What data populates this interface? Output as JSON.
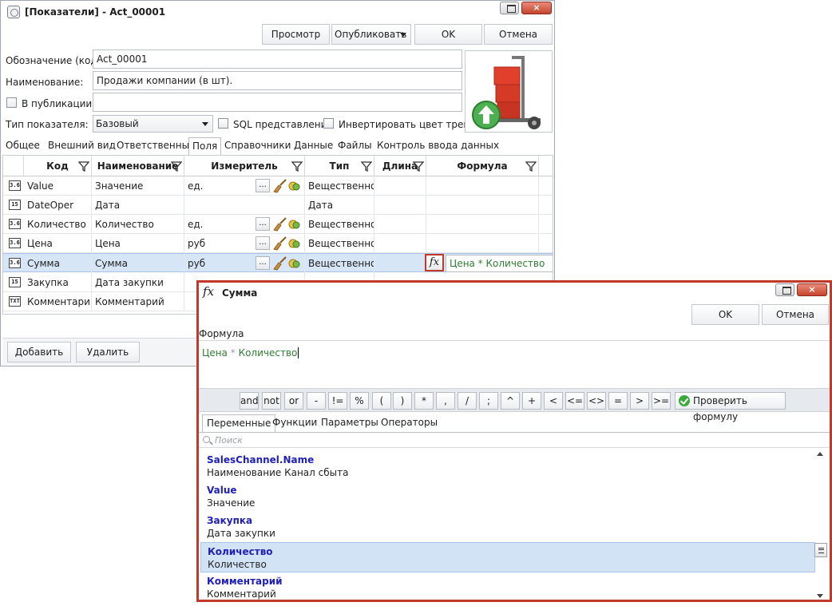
{
  "main": {
    "title": "[Показатели] - Act_00001",
    "toolbar": {
      "preview": "Просмотр",
      "publish": "Опубликовать",
      "ok": "OK",
      "cancel": "Отмена"
    },
    "form": {
      "code_label": "Обозначение (код):",
      "code_value": "Act_00001",
      "name_label": "Наименование:",
      "name_value": "Продажи компании (в шт).",
      "publication_label": "В публикации:",
      "publication_value": "",
      "type_label": "Тип показателя:",
      "type_value": "Базовый",
      "sql_label": "SQL представление",
      "invert_label": "Инвертировать цвет тренда"
    },
    "tabs": [
      "Общее",
      "Внешний вид",
      "Ответственные",
      "Поля",
      "Справочники",
      "Данные",
      "Файлы",
      "Контроль ввода данных"
    ],
    "active_tab": "Поля",
    "grid": {
      "headers": [
        "Код",
        "Наименование",
        "Измеритель",
        "Тип",
        "Длина",
        "Формула"
      ],
      "rows": [
        {
          "icon": "3.6",
          "code": "Value",
          "name": "Значение",
          "unit": "ед.",
          "type": "Вещественное",
          "formula": ""
        },
        {
          "icon": "15",
          "code": "DateOper",
          "name": "Дата",
          "unit": "",
          "type": "Дата",
          "formula": ""
        },
        {
          "icon": "3.6",
          "code": "Количество",
          "name": "Количество",
          "unit": "ед.",
          "type": "Вещественное",
          "formula": ""
        },
        {
          "icon": "3.6",
          "code": "Цена",
          "name": "Цена",
          "unit": "руб",
          "type": "Вещественное",
          "formula": ""
        },
        {
          "icon": "3.6",
          "code": "Сумма",
          "name": "Сумма",
          "unit": "руб",
          "type": "Вещественное",
          "formula": "Цена * Количество"
        },
        {
          "icon": "15",
          "code": "Закупка",
          "name": "Дата закупки",
          "unit": "",
          "type": "",
          "formula": ""
        },
        {
          "icon": "TXT",
          "code": "Комментарий",
          "name": "Комментарий",
          "unit": "",
          "type": "",
          "formula": ""
        }
      ],
      "ellipsis": "..."
    },
    "bottom": {
      "add": "Добавить",
      "delete": "Удалить"
    }
  },
  "dialog": {
    "title": "Сумма",
    "fx_glyph": "fx",
    "ok": "OK",
    "cancel": "Отмена",
    "formula_label": "Формула",
    "formula_name": "Цена",
    "formula_op": "*",
    "formula_qty": "Количество",
    "operators": [
      "and",
      "not",
      "or",
      "-",
      "!=",
      "%",
      "(",
      ")",
      "*",
      ",",
      "/",
      ";",
      "^",
      "+",
      "<",
      "<=",
      "<>",
      "=",
      ">",
      ">="
    ],
    "check_formula": "Проверить формулу",
    "tabs": [
      "Переменные",
      "Функции",
      "Параметры",
      "Операторы"
    ],
    "active_tab": "Переменные",
    "search_placeholder": "Поиск",
    "variables": [
      {
        "name": "SalesChannel.Name",
        "desc": "Наименование Канал сбыта"
      },
      {
        "name": "Value",
        "desc": "Значение"
      },
      {
        "name": "Закупка",
        "desc": "Дата закупки"
      },
      {
        "name": "Количество",
        "desc": "Количество"
      },
      {
        "name": "Комментарий",
        "desc": "Комментарий"
      }
    ],
    "selected_variable": "Количество"
  },
  "colors": {
    "accent_red": "#c0392b",
    "selection_blue": "#d7e6f7",
    "formula_green": "#2e7d32",
    "variable_blue": "#2020b8"
  }
}
